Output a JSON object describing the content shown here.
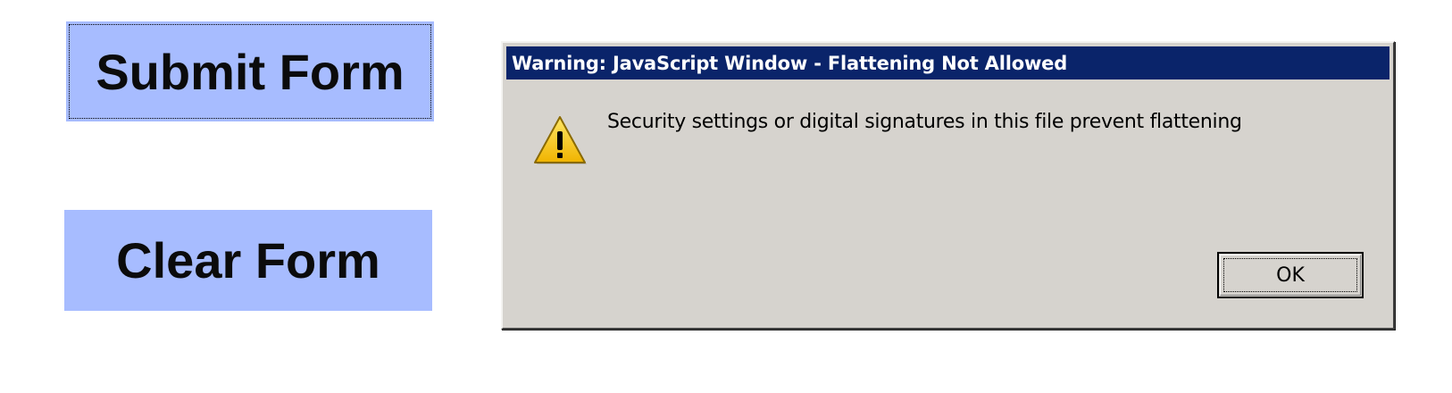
{
  "form_buttons": {
    "submit_label": "Submit Form",
    "clear_label": "Clear Form"
  },
  "dialog": {
    "title": "Warning: JavaScript Window - Flattening Not Allowed",
    "message": "Security settings or digital signatures in this file prevent flattening",
    "icon": "warning-triangle-icon",
    "ok_label": "OK"
  },
  "colors": {
    "form_button_bg": "#a7bcff",
    "dialog_bg": "#d6d3ce",
    "titlebar_bg": "#0a246a",
    "warning_yellow": "#f5c400"
  }
}
